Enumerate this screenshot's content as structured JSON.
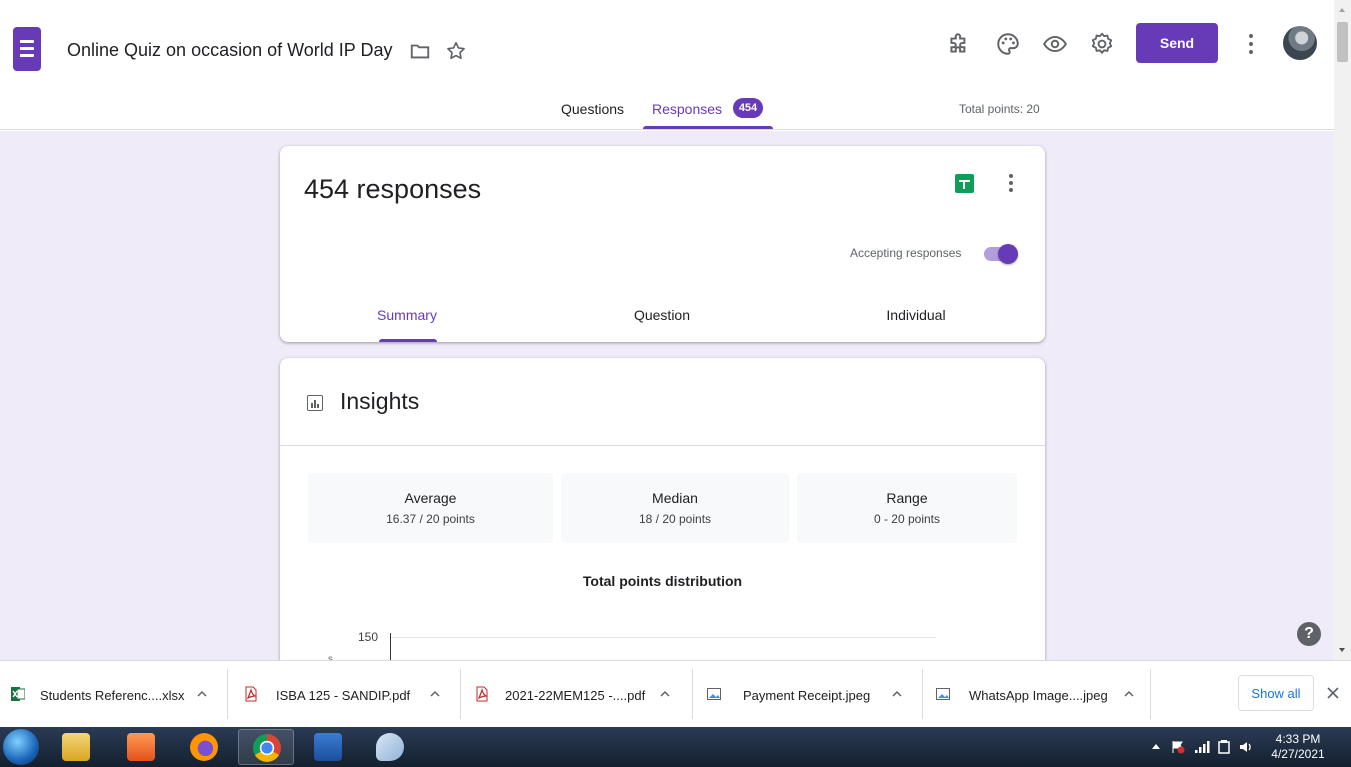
{
  "header": {
    "title": "Online Quiz on occasion of World IP Day",
    "send_label": "Send",
    "tabs": {
      "questions": "Questions",
      "responses": "Responses",
      "responses_count": "454"
    },
    "total_points": "Total points: 20"
  },
  "responses_card": {
    "count_label": "454 responses",
    "accepting_label": "Accepting responses",
    "accepting": true,
    "tabs": {
      "summary": "Summary",
      "question": "Question",
      "individual": "Individual"
    }
  },
  "insights": {
    "title": "Insights",
    "stats": {
      "average": {
        "label": "Average",
        "value": "16.37 / 20 points"
      },
      "median": {
        "label": "Median",
        "value": "18 / 20 points"
      },
      "range": {
        "label": "Range",
        "value": "0 - 20 points"
      }
    },
    "distribution_title": "Total points distribution",
    "y_tick_top": "150",
    "y_axis_label_partial": "s"
  },
  "downloads": {
    "items": [
      {
        "name": "Students Referenc....xlsx",
        "type": "excel"
      },
      {
        "name": "ISBA 125 - SANDIP.pdf",
        "type": "pdf"
      },
      {
        "name": "2021-22MEM125 -....pdf",
        "type": "pdf"
      },
      {
        "name": "Payment Receipt.jpeg",
        "type": "image"
      },
      {
        "name": "WhatsApp Image....jpeg",
        "type": "image"
      }
    ],
    "show_all": "Show all"
  },
  "taskbar": {
    "time": "4:33 PM",
    "date": "4/27/2021"
  },
  "colors": {
    "accent": "#673ab7",
    "background": "#f0ebf8",
    "sheets_green": "#0f9d58"
  },
  "icons": [
    "forms-logo-icon",
    "folder-icon",
    "star-icon",
    "addon-puzzle-icon",
    "palette-icon",
    "preview-eye-icon",
    "settings-gear-icon",
    "more-vert-icon",
    "sheets-icon",
    "insights-chart-icon",
    "help-icon",
    "chevron-up-icon",
    "close-icon"
  ]
}
